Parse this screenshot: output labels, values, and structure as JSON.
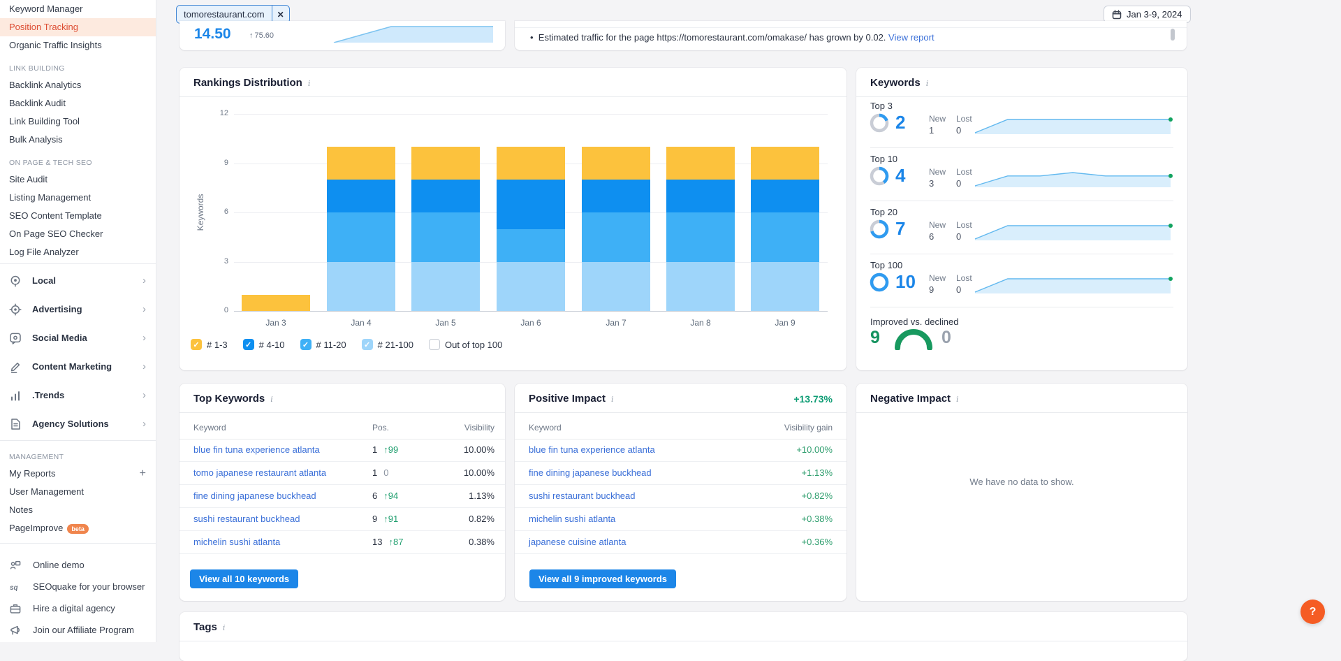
{
  "topbar": {
    "project_chip": "tomorestaurant.com",
    "chip_close": "✕",
    "date_range": "Jan 3-9, 2024"
  },
  "visibility_card": {
    "value": "14.50",
    "change": "75.60",
    "change_dir": "up"
  },
  "notes_card": {
    "bullet": "•",
    "text": "Estimated traffic for the page https://tomorestaurant.com/omakase/ has grown by 0.02.",
    "link": "View report"
  },
  "sidebar": {
    "top_items": [
      {
        "label": "Keyword Manager",
        "active": false
      },
      {
        "label": "Position Tracking",
        "active": true
      },
      {
        "label": "Organic Traffic Insights",
        "active": false
      }
    ],
    "sections": [
      {
        "heading": "LINK BUILDING",
        "items": [
          "Backlink Analytics",
          "Backlink Audit",
          "Link Building Tool",
          "Bulk Analysis"
        ]
      },
      {
        "heading": "ON PAGE & TECH SEO",
        "items": [
          "Site Audit",
          "Listing Management",
          "SEO Content Template",
          "On Page SEO Checker",
          "Log File Analyzer"
        ]
      }
    ],
    "suites": [
      {
        "label": "Local",
        "icon": "location-pin-icon"
      },
      {
        "label": "Advertising",
        "icon": "target-icon"
      },
      {
        "label": "Social Media",
        "icon": "chat-bubble-icon"
      },
      {
        "label": "Content Marketing",
        "icon": "pencil-icon"
      },
      {
        "label": ".Trends",
        "icon": "bar-chart-icon"
      },
      {
        "label": "Agency Solutions",
        "icon": "document-icon"
      }
    ],
    "management": {
      "heading": "MANAGEMENT",
      "items": [
        {
          "label": "My Reports",
          "action": "+"
        },
        {
          "label": "User Management"
        },
        {
          "label": "Notes"
        },
        {
          "label": "PageImprove",
          "badge": "beta"
        }
      ]
    },
    "footer_items": [
      {
        "label": "Online demo",
        "icon": "presenter-icon"
      },
      {
        "label": "SEOquake for your browser",
        "icon": "seoquake-icon"
      },
      {
        "label": "Hire a digital agency",
        "icon": "briefcase-icon"
      },
      {
        "label": "Join our Affiliate Program",
        "icon": "megaphone-icon"
      }
    ]
  },
  "chart_data": {
    "type": "bar",
    "stacked": true,
    "title": "Rankings Distribution",
    "ylabel": "Keywords",
    "ylim": [
      0,
      12
    ],
    "yticks": [
      0,
      3,
      6,
      9,
      12
    ],
    "categories": [
      "Jan 3",
      "Jan 4",
      "Jan 5",
      "Jan 6",
      "Jan 7",
      "Jan 8",
      "Jan 9"
    ],
    "series": [
      {
        "name": "# 21-100",
        "color": "#9ed5fa",
        "values": [
          0,
          3,
          3,
          3,
          3,
          3,
          3
        ]
      },
      {
        "name": "# 11-20",
        "color": "#3eb0f6",
        "values": [
          0,
          3,
          3,
          2,
          3,
          3,
          3
        ]
      },
      {
        "name": "# 4-10",
        "color": "#0e8ff0",
        "values": [
          0,
          2,
          2,
          3,
          2,
          2,
          2
        ]
      },
      {
        "name": "# 1-3",
        "color": "#fcc23d",
        "values": [
          1,
          2,
          2,
          2,
          2,
          2,
          2
        ]
      }
    ],
    "legend": [
      {
        "label": "# 1-3",
        "color": "#fcc23d",
        "checked": true
      },
      {
        "label": "# 4-10",
        "color": "#0e8ff0",
        "checked": true
      },
      {
        "label": "# 11-20",
        "color": "#3eb0f6",
        "checked": true
      },
      {
        "label": "# 21-100",
        "color": "#9ed5fa",
        "checked": true
      },
      {
        "label": "Out of top 100",
        "color": "#ffffff",
        "checked": false
      }
    ],
    "legend_position": "bottom",
    "grid": true
  },
  "keywords_panel": {
    "title": "Keywords",
    "rows": [
      {
        "label": "Top 3",
        "value": 2,
        "total": 10,
        "new_label": "New",
        "new": 1,
        "lost_label": "Lost",
        "lost": 0,
        "trend": [
          1,
          2,
          2,
          2,
          2,
          2,
          2
        ]
      },
      {
        "label": "Top 10",
        "value": 4,
        "total": 10,
        "new_label": "New",
        "new": 3,
        "lost_label": "Lost",
        "lost": 0,
        "trend": [
          1,
          4,
          4,
          5,
          4,
          4,
          4
        ]
      },
      {
        "label": "Top 20",
        "value": 7,
        "total": 10,
        "new_label": "New",
        "new": 6,
        "lost_label": "Lost",
        "lost": 0,
        "trend": [
          1,
          7,
          7,
          7,
          7,
          7,
          7
        ]
      },
      {
        "label": "Top 100",
        "value": 10,
        "total": 10,
        "new_label": "New",
        "new": 9,
        "lost_label": "Lost",
        "lost": 0,
        "trend": [
          1,
          10,
          10,
          10,
          10,
          10,
          10
        ]
      }
    ],
    "improved": {
      "label": "Improved vs. declined",
      "improved": 9,
      "declined": 0
    }
  },
  "top_keywords": {
    "title": "Top Keywords",
    "columns": [
      "Keyword",
      "Pos.",
      "Visibility"
    ],
    "rows": [
      {
        "keyword": "blue fin tuna experience atlanta",
        "pos": "1",
        "diff": "99",
        "diff_dir": "up",
        "visibility": "10.00%"
      },
      {
        "keyword": "tomo japanese restaurant atlanta",
        "pos": "1",
        "diff": "0",
        "diff_dir": "none",
        "visibility": "10.00%"
      },
      {
        "keyword": "fine dining japanese buckhead",
        "pos": "6",
        "diff": "94",
        "diff_dir": "up",
        "visibility": "1.13%"
      },
      {
        "keyword": "sushi restaurant buckhead",
        "pos": "9",
        "diff": "91",
        "diff_dir": "up",
        "visibility": "0.82%"
      },
      {
        "keyword": "michelin sushi atlanta",
        "pos": "13",
        "diff": "87",
        "diff_dir": "up",
        "visibility": "0.38%"
      }
    ],
    "button": "View all 10 keywords"
  },
  "positive_impact": {
    "title": "Positive Impact",
    "total_gain": "+13.73%",
    "columns": [
      "Keyword",
      "Visibility gain"
    ],
    "rows": [
      {
        "keyword": "blue fin tuna experience atlanta",
        "gain": "+10.00%"
      },
      {
        "keyword": "fine dining japanese buckhead",
        "gain": "+1.13%"
      },
      {
        "keyword": "sushi restaurant buckhead",
        "gain": "+0.82%"
      },
      {
        "keyword": "michelin sushi atlanta",
        "gain": "+0.38%"
      },
      {
        "keyword": "japanese cuisine atlanta",
        "gain": "+0.36%"
      }
    ],
    "button": "View all 9 improved keywords"
  },
  "negative_impact": {
    "title": "Negative Impact",
    "empty_text": "We have no data to show."
  },
  "tags_panel": {
    "title": "Tags"
  },
  "help_button": "?",
  "colors": {
    "accent_blue": "#1a85e8",
    "link_blue": "#3a6fd8",
    "green": "#1f9e6e",
    "active_item_bg": "#fdeadf",
    "active_item_text": "#dd4d33",
    "help_orange": "#f55c24"
  }
}
